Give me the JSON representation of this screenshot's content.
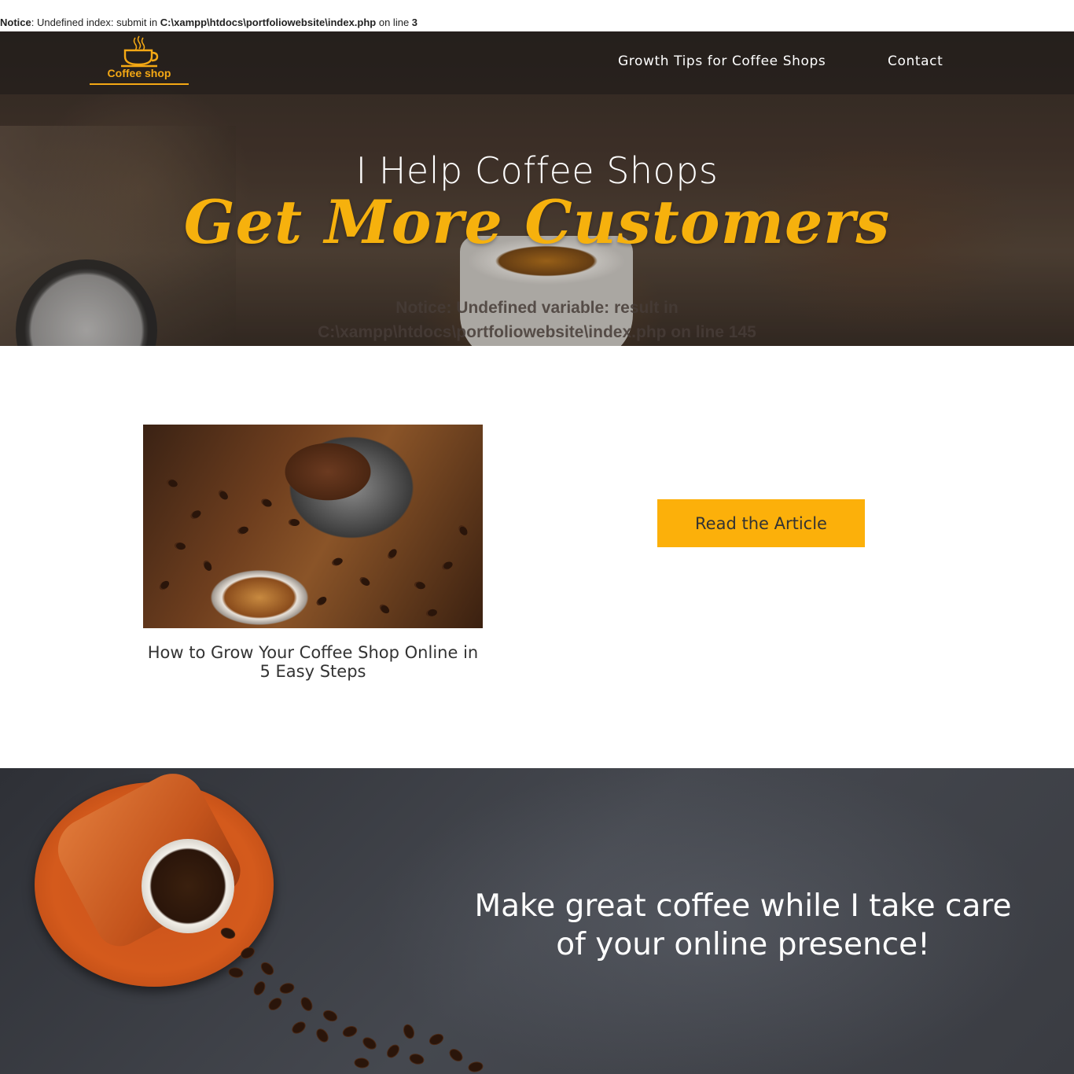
{
  "php_notice": {
    "label": "Notice",
    "message": ": Undefined index: submit in ",
    "path": "C:\\xampp\\htdocs\\portfoliowebsite\\index.php",
    "line_text": " on line ",
    "line_number": "3"
  },
  "header": {
    "logo_text": "Coffee shop",
    "nav": [
      {
        "label": "Growth Tips for Coffee Shops"
      },
      {
        "label": "Contact"
      }
    ]
  },
  "hero": {
    "title": "I Help Coffee Shops",
    "script": "Get More Customers",
    "notice_line1": "Notice: Undefined variable: result in",
    "notice_line2": "C:\\xampp\\htdocs\\portfoliowebsite\\index.php on line 145"
  },
  "article": {
    "title": "How to Grow Your Coffee Shop Online in 5 Easy Steps",
    "button_label": "Read the Article"
  },
  "banner": {
    "text": "Make great coffee while I take care of your online presence!"
  },
  "colors": {
    "accent": "#fcb00a",
    "script_gold": "#f6b10d",
    "logo_gold": "#f4a814"
  }
}
